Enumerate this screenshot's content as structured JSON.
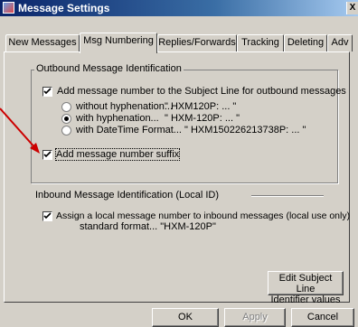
{
  "window": {
    "title": "Message Settings",
    "close_glyph": "X"
  },
  "tabs": [
    "New Messages",
    "Msg Numbering",
    "Replies/Forwards",
    "Tracking",
    "Deleting",
    "Adv"
  ],
  "active_tab": "Msg Numbering",
  "outbound": {
    "legend": "Outbound Message Identification",
    "add_number_label": "Add message number to the Subject Line for outbound messages",
    "add_number_checked": true,
    "options": [
      {
        "label": "without hyphenation...",
        "example": "\" HXM120P: ... \"",
        "selected": false
      },
      {
        "label": "with hyphenation...",
        "example": "\" HXM-120P: ... \"",
        "selected": true
      },
      {
        "label": "with DateTime Format...",
        "example": "\" HXM150226213738P: ... \"",
        "selected": false
      }
    ],
    "suffix_label": "Add message number suffix",
    "suffix_checked": true
  },
  "inbound": {
    "legend": "Inbound Message Identification (Local ID)",
    "assign_label": "Assign a local message number to inbound messages (local use only)",
    "assign_checked": true,
    "format_text": "standard format...  \"HXM-120P\""
  },
  "buttons": {
    "edit_line1": "Edit Subject Line",
    "edit_line2": "Identifier values",
    "ok": "OK",
    "apply": "Apply",
    "cancel": "Cancel"
  },
  "colors": {
    "annotation_arrow": "#cc0000",
    "dialog_face": "#d4d0c8",
    "title_blue": "#0a246a"
  }
}
